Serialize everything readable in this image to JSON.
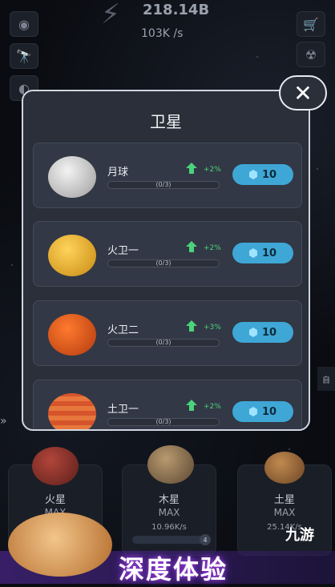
{
  "top": {
    "amount": "218.14B",
    "rate": "103K /s"
  },
  "modal": {
    "title": "卫星",
    "close": "✕"
  },
  "items": [
    {
      "name": "月球",
      "bonus": "+2%",
      "progress": "(0/3)",
      "price": "10"
    },
    {
      "name": "火卫一",
      "bonus": "+2%",
      "progress": "(0/3)",
      "price": "10"
    },
    {
      "name": "火卫二",
      "bonus": "+3%",
      "progress": "(0/3)",
      "price": "10"
    },
    {
      "name": "土卫一",
      "bonus": "+2%",
      "progress": "(0/3)",
      "price": "10"
    }
  ],
  "planets": [
    {
      "name": "火星",
      "status": "MAX"
    },
    {
      "name": "木星",
      "status": "MAX",
      "rate": "10.96K/s",
      "level": "4"
    },
    {
      "name": "土星",
      "status": "MAX",
      "rate": "25.14K/s"
    }
  ],
  "banner": {
    "text": "深度体验",
    "logo": "九游"
  },
  "side_tab": "自"
}
